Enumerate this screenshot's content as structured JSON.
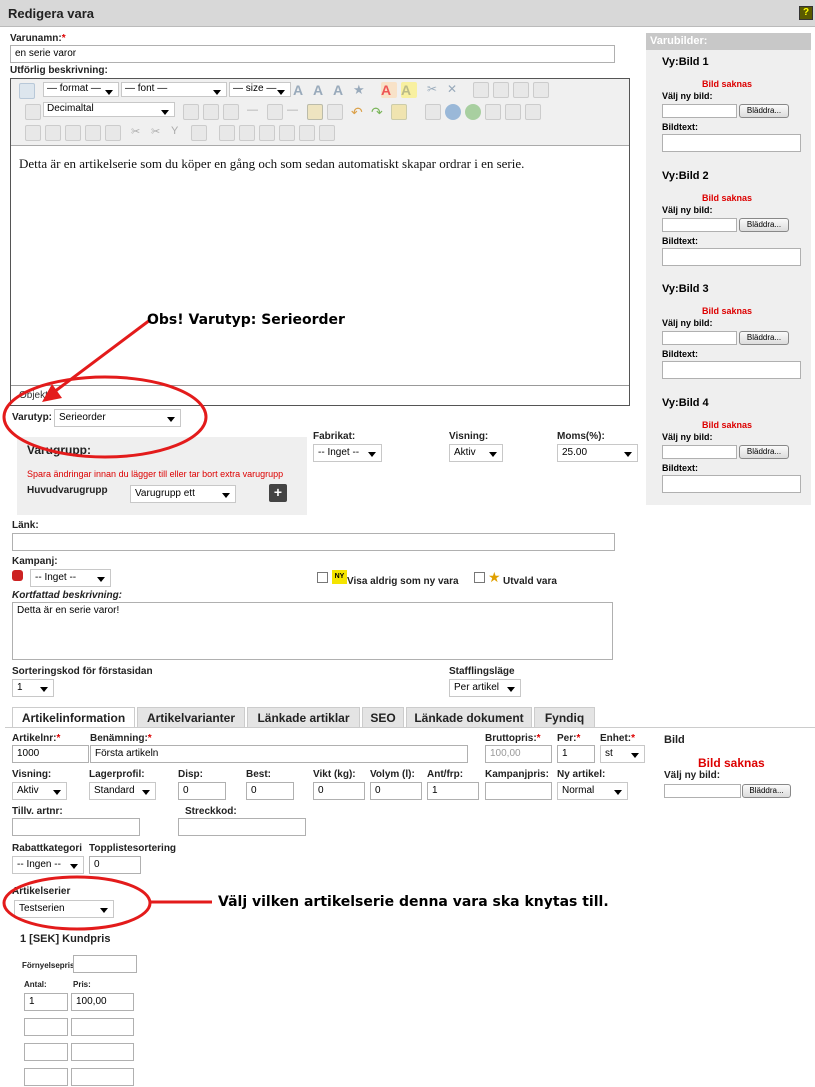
{
  "window": {
    "title": "Redigera vara",
    "help_label": "?"
  },
  "form": {
    "varunamn_label": "Varunamn:",
    "required_mark": "*",
    "varunamn_value": "en serie varor",
    "beskrivning_label": "Utförlig beskrivning:",
    "editor": {
      "format": "— format —",
      "font": "— font —",
      "size": "— size —",
      "list_style": "Decimaltal",
      "content": "Detta är en artikelserie som du köper en gång och som sedan automatiskt skapar ordrar i en serie.",
      "footer": "Objekt:"
    },
    "varutyp_label": "Varutyp:",
    "varutyp_value": "Serieorder",
    "varugrupp": {
      "title": "Varugrupp:",
      "warning": "Spara ändringar innan du lägger till eller tar bort extra varugrupp",
      "huvud_label": "Huvudvarugrupp",
      "huvud_value": "Varugrupp ett",
      "add_label": "+"
    },
    "fabrikat_label": "Fabrikat:",
    "fabrikat_value": "-- Inget --",
    "visning_label": "Visning:",
    "visning_value": "Aktiv",
    "moms_label": "Moms(%):",
    "moms_value": "25.00",
    "lank_label": "Länk:",
    "kampanj_label": "Kampanj:",
    "kampanj_value": "-- Inget --",
    "visa_aldrig_label": "Visa aldrig som ny vara",
    "new_badge": "NY",
    "utvald_label": "Utvald vara",
    "kortfattad_label": "Kortfattad beskrivning:",
    "kortfattad_value": "Detta är en serie varor!",
    "sortering_label": "Sorteringskod för förstasidan",
    "sortering_value": "1",
    "stafflings_label": "Stafflingsläge",
    "stafflings_value": "Per artikel"
  },
  "sidebar": {
    "title": "Varubilder:",
    "slots": [
      {
        "title": "Vy:Bild 1",
        "missing": "Bild saknas",
        "choose_label": "Välj ny bild:",
        "browse": "Bläddra...",
        "caption_label": "Bildtext:"
      },
      {
        "title": "Vy:Bild 2",
        "missing": "Bild saknas",
        "choose_label": "Välj ny bild:",
        "browse": "Bläddra...",
        "caption_label": "Bildtext:"
      },
      {
        "title": "Vy:Bild 3",
        "missing": "Bild saknas",
        "choose_label": "Välj ny bild:",
        "browse": "Bläddra...",
        "caption_label": "Bildtext:"
      },
      {
        "title": "Vy:Bild 4",
        "missing": "Bild saknas",
        "choose_label": "Välj ny bild:",
        "browse": "Bläddra...",
        "caption_label": "Bildtext:"
      }
    ]
  },
  "tabs": [
    "Artikelinformation",
    "Artikelvarianter",
    "Länkade artiklar",
    "SEO",
    "Länkade dokument",
    "Fyndiq"
  ],
  "article": {
    "artikelnr_label": "Artikelnr:",
    "artikelnr_value": "1000",
    "benamning_label": "Benämning:",
    "benamning_value": "Första artikeln",
    "bruttopris_label": "Bruttopris:",
    "bruttopris_placeholder": "100,00",
    "per_label": "Per:",
    "per_value": "1",
    "enhet_label": "Enhet:",
    "enhet_value": "st",
    "bild_label": "Bild",
    "bild_missing": "Bild saknas",
    "valj_label": "Välj ny bild:",
    "browse": "Bläddra...",
    "visning_label": "Visning:",
    "visning_value": "Aktiv",
    "lagerprofil_label": "Lagerprofil:",
    "lagerprofil_value": "Standard",
    "disp_label": "Disp:",
    "disp_value": "0",
    "best_label": "Best:",
    "best_value": "0",
    "vikt_label": "Vikt (kg):",
    "vikt_value": "0",
    "volym_label": "Volym (l):",
    "volym_value": "0",
    "antfrp_label": "Ant/frp:",
    "antfrp_value": "1",
    "kampanjpris_label": "Kampanjpris:",
    "ny_artikel_label": "Ny artikel:",
    "ny_artikel_value": "Normal",
    "tillv_label": "Tillv. artnr:",
    "streckkod_label": "Streckkod:",
    "rabatt_label": "Rabattkategori",
    "rabatt_value": "-- Ingen --",
    "topplista_label": "Topplistesortering",
    "topplista_value": "0",
    "artikelserier_label": "Artikelserier",
    "artikelserier_value": "Testserien",
    "kundpris_title": "1 [SEK] Kundpris",
    "fornyelse_label": "Förnyelsepris",
    "antal_label": "Antal:",
    "pris_label": "Pris:",
    "antal_value": "1",
    "pris_value": "100,00"
  },
  "annotations": {
    "varutyp_note": "Obs! Varutyp: Serieorder",
    "serie_note": "Välj vilken artikelserie denna vara ska knytas till."
  }
}
